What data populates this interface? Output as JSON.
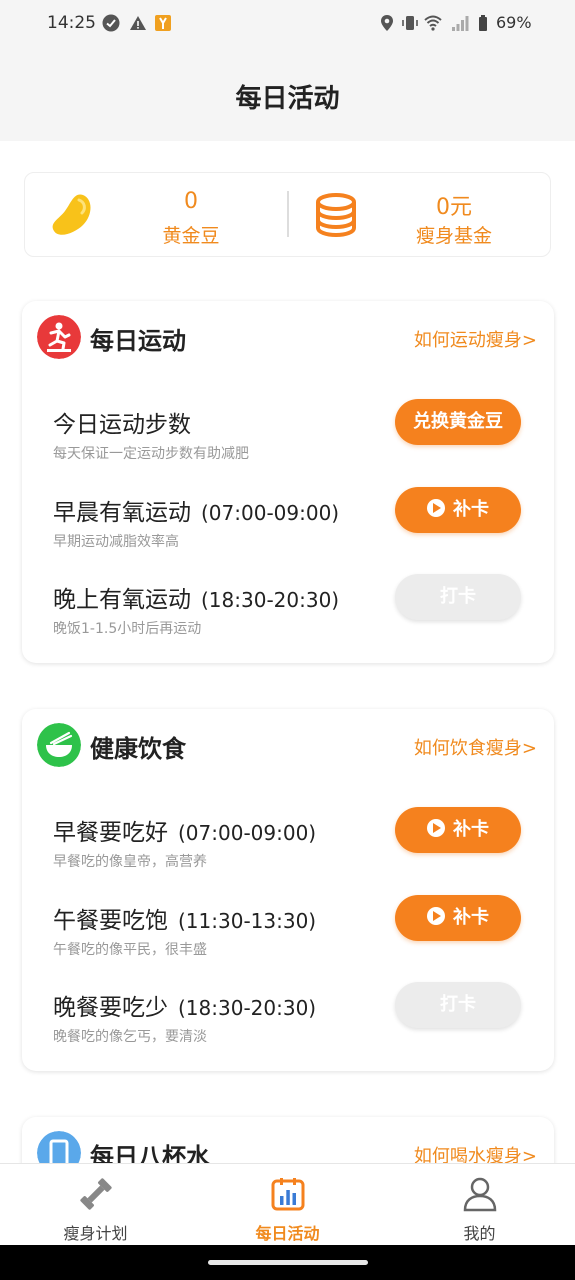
{
  "status_bar": {
    "time": "14:25",
    "battery_percent": "69%",
    "icons": [
      "check-circle-icon",
      "warning-icon",
      "app-notification-icon",
      "location-icon",
      "vibrate-icon",
      "wifi-icon",
      "signal-icon",
      "battery-icon"
    ]
  },
  "header": {
    "title": "每日活动"
  },
  "stats": {
    "beans": {
      "value": "0",
      "label": "黄金豆",
      "icon": "bean-icon"
    },
    "fund": {
      "value": "0元",
      "label": "瘦身基金",
      "icon": "coins-icon"
    }
  },
  "exercise": {
    "title": "每日运动",
    "link": "如何运动瘦身>",
    "icon": "exercise-icon",
    "tasks": [
      {
        "name": "今日运动步数",
        "time": "",
        "desc": "每天保证一定运动步数有助减肥",
        "button": "兑换黄金豆",
        "style": "orange"
      },
      {
        "name": "早晨有氧运动",
        "time": "(07:00-09:00)",
        "desc": "早期运动减脂效率高",
        "button": "补卡",
        "style": "orange-play"
      },
      {
        "name": "晚上有氧运动",
        "time": "(18:30-20:30)",
        "desc": "晚饭1-1.5小时后再运动",
        "button": "打卡",
        "style": "gray"
      }
    ]
  },
  "diet": {
    "title": "健康饮食",
    "link": "如何饮食瘦身>",
    "icon": "bowl-icon",
    "tasks": [
      {
        "name": "早餐要吃好",
        "time": "(07:00-09:00)",
        "desc": "早餐吃的像皇帝，高营养",
        "button": "补卡",
        "style": "orange-play"
      },
      {
        "name": "午餐要吃饱",
        "time": "(11:30-13:30)",
        "desc": "午餐吃的像平民，很丰盛",
        "button": "补卡",
        "style": "orange-play"
      },
      {
        "name": "晚餐要吃少",
        "time": "(18:30-20:30)",
        "desc": "晚餐吃的像乞丐，要清淡",
        "button": "打卡",
        "style": "gray"
      }
    ]
  },
  "water": {
    "title": "每日八杯水",
    "link": "如何喝水瘦身>",
    "icon": "water-cup-icon"
  },
  "tabbar": {
    "tabs": [
      {
        "label": "瘦身计划",
        "icon": "dumbbell-icon"
      },
      {
        "label": "每日活动",
        "icon": "calendar-chart-icon",
        "active": true
      },
      {
        "label": "我的",
        "icon": "person-icon"
      }
    ]
  },
  "colors": {
    "accent": "#f5811e",
    "red_icon": "#e8393a",
    "green_icon": "#2ec24a",
    "blue_icon": "#5aa8ea"
  }
}
